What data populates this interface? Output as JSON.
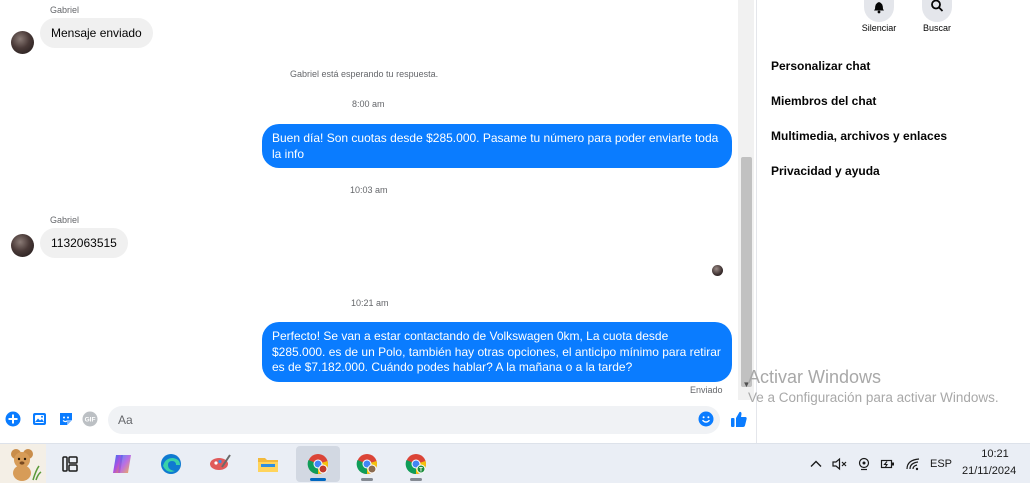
{
  "chat": {
    "messages": [
      {
        "sender": "Gabriel",
        "text": "Mensaje enviado"
      },
      {
        "sender": "Gabriel",
        "text": "1132063515"
      }
    ],
    "system_notice": "Gabriel está esperando tu respuesta.",
    "timestamps": [
      "8:00 am",
      "10:03 am",
      "10:21 am"
    ],
    "outgoing": [
      "Buen día! Son cuotas desde $285.000. Pasame tu número para poder enviarte toda la info",
      "Perfecto!  Se van a estar contactando de Volkswagen 0km, La cuota desde $285.000. es de un Polo, también hay otras opciones, el anticipo mínimo para retirar es de $7.182.000. Cuándo podes hablar? A la mañana o a la tarde?"
    ],
    "status": "Enviado"
  },
  "composer": {
    "placeholder": "Aa",
    "icons": [
      "plus-circle-icon",
      "photo-icon",
      "sticker-icon",
      "gif-icon",
      "emoji-icon",
      "thumbs-up-icon"
    ],
    "gif_label": "GIF"
  },
  "panel": {
    "actions": [
      {
        "label": "Silenciar",
        "icon": "bell-icon"
      },
      {
        "label": "Buscar",
        "icon": "search-icon"
      }
    ],
    "items": [
      "Personalizar chat",
      "Miembros del chat",
      "Multimedia, archivos y enlaces",
      "Privacidad y ayuda"
    ]
  },
  "watermark": {
    "line1": "Activar Windows",
    "line2": "Ve a Configuración para activar Windows."
  },
  "taskbar": {
    "apps": [
      "teddy-bear-icon",
      "task-view-icon",
      "copilot-icon",
      "edge-icon",
      "paint-icon",
      "file-explorer-icon",
      "chrome-icon",
      "chrome-profile-icon",
      "chrome-t-icon"
    ],
    "tray": {
      "lang": "ESP",
      "time": "10:21",
      "date": "21/11/2024"
    },
    "colors": {
      "accent": "#0067c0",
      "bubble": "#0a7cff"
    }
  }
}
